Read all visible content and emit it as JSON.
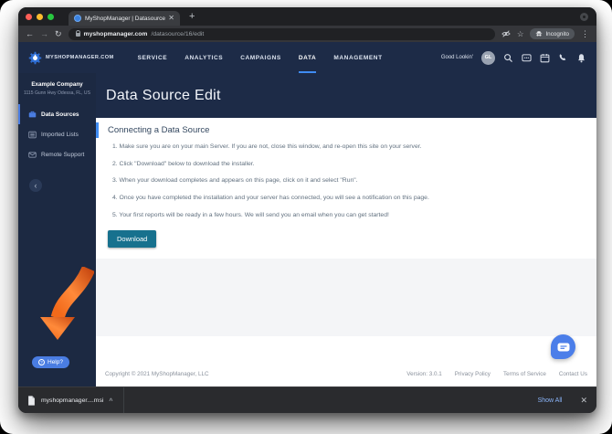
{
  "browser": {
    "tab_title": "MyShopManager | Datasource",
    "url_domain": "myshopmanager.com",
    "url_path": "/datasource/16/edit",
    "incognito_label": "Incognito"
  },
  "app_header": {
    "brand": "MyShopManager.Com",
    "nav": [
      {
        "label": "SERVICE"
      },
      {
        "label": "ANALYTICS"
      },
      {
        "label": "CAMPAIGNS"
      },
      {
        "label": "DATA"
      },
      {
        "label": "MANAGEMENT"
      }
    ],
    "greeting": "Good Lookin'",
    "avatar_initials": "GL"
  },
  "sidebar": {
    "company": "Example Company",
    "address": "1115 Gunn Hwy Odessa, FL, US",
    "items": [
      {
        "label": "Data Sources"
      },
      {
        "label": "Imported Lists"
      },
      {
        "label": "Remote Support"
      }
    ],
    "help_label": "Help?"
  },
  "main": {
    "page_title": "Data Source Edit",
    "card_title": "Connecting a Data Source",
    "steps": [
      "1. Make sure you are on your main Server. If you are not, close this window, and re-open this site on your server.",
      "2. Click \"Download\" below to download the installer.",
      "3. When your download completes and appears on this page, click on it and select \"Run\".",
      "4. Once you have completed the installation and your server has connected, you will see a notification on this page.",
      "5. Your first reports will be ready in a few hours. We will send you an email when you can get started!"
    ],
    "download_label": "Download"
  },
  "footer": {
    "copyright": "Copyright © 2021 MyShopManager, LLC",
    "version": "Version: 3.0.1",
    "links": [
      "Privacy Policy",
      "Terms of Service",
      "Contact Us"
    ]
  },
  "download_bar": {
    "filename": "myshopmanager....msi",
    "show_all_label": "Show All"
  },
  "colors": {
    "app_navy": "#1d2b47",
    "nav_active_underline": "#3f8cf3",
    "sidebar_active_blue": "#4a7de2",
    "download_button": "#17718e",
    "help_and_chat_blue": "#4b7ee9",
    "arrow_orange": "#f26a1b"
  }
}
